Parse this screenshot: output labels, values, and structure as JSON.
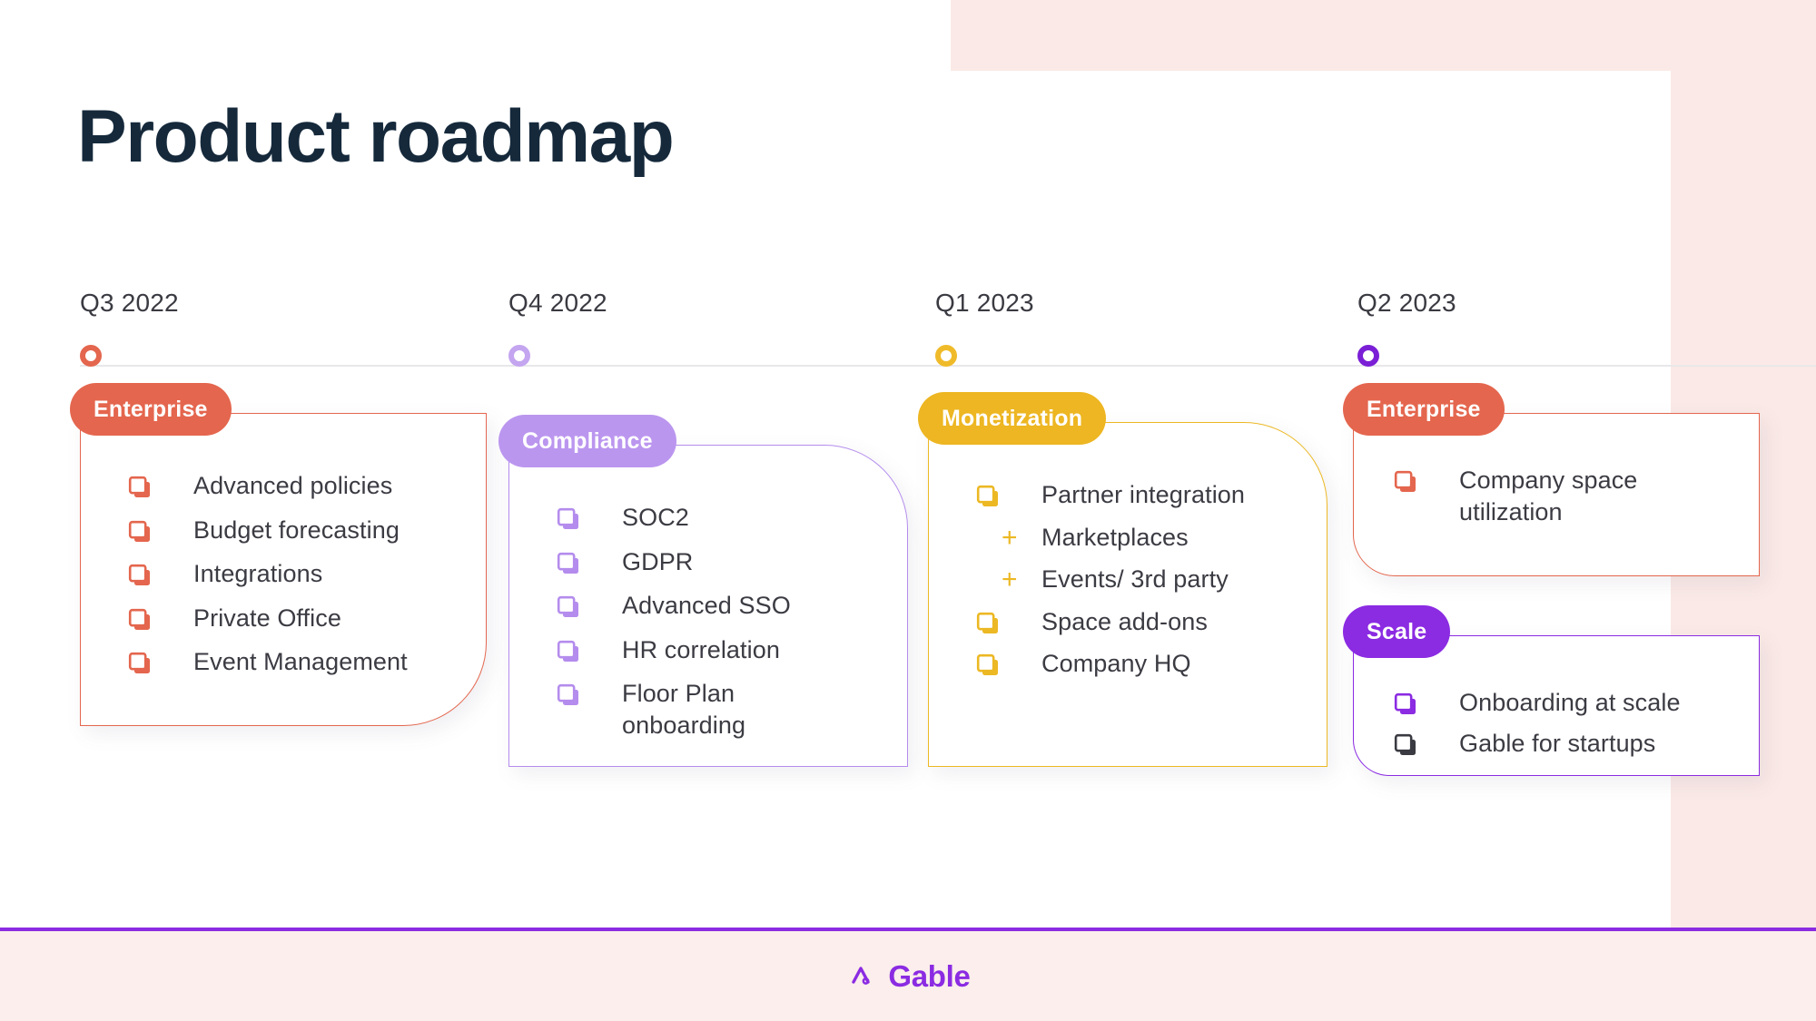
{
  "slide": {
    "title": "Product roadmap",
    "title_color": "#15293b",
    "background_color": "#ffffff",
    "accent_block_color": "#fae9e6"
  },
  "timeline": {
    "line_color": "#e8e8ea",
    "quarters": [
      {
        "label": "Q3 2022",
        "dot_color": "#e4664e"
      },
      {
        "label": "Q4 2022",
        "dot_color": "#c4a5f0"
      },
      {
        "label": "Q1 2023",
        "dot_color": "#f0bb2a"
      },
      {
        "label": "Q2 2023",
        "dot_color": "#7a1fd6"
      }
    ]
  },
  "columns": [
    {
      "quarter": "Q3 2022",
      "cards": [
        {
          "pill_label": "Enterprise",
          "color": "#e4664e",
          "pill_bg": "#e4664e",
          "items": [
            {
              "marker": "duplicate-icon",
              "text": "Advanced policies",
              "marker_color": "#e4664e"
            },
            {
              "marker": "duplicate-icon",
              "text": "Budget forecasting",
              "marker_color": "#e4664e"
            },
            {
              "marker": "duplicate-icon",
              "text": "Integrations",
              "marker_color": "#e4664e"
            },
            {
              "marker": "duplicate-icon",
              "text": "Private Office",
              "marker_color": "#e4664e"
            },
            {
              "marker": "duplicate-icon",
              "text": "Event Management",
              "marker_color": "#e4664e"
            }
          ]
        }
      ]
    },
    {
      "quarter": "Q4 2022",
      "cards": [
        {
          "pill_label": "Compliance",
          "color": "#b48ced",
          "pill_bg": "#bb96ef",
          "items": [
            {
              "marker": "duplicate-icon",
              "text": "SOC2",
              "marker_color": "#b48ced"
            },
            {
              "marker": "duplicate-icon",
              "text": "GDPR",
              "marker_color": "#b48ced"
            },
            {
              "marker": "duplicate-icon",
              "text": "Advanced SSO",
              "marker_color": "#b48ced"
            },
            {
              "marker": "duplicate-icon",
              "text": "HR correlation",
              "marker_color": "#b48ced"
            },
            {
              "marker": "duplicate-icon",
              "text": "Floor Plan onboarding",
              "marker_color": "#b48ced"
            }
          ]
        }
      ]
    },
    {
      "quarter": "Q1 2023",
      "cards": [
        {
          "pill_label": "Monetization",
          "color": "#ecb823",
          "pill_bg": "#edb622",
          "items": [
            {
              "marker": "duplicate-icon",
              "text": "Partner integration",
              "marker_color": "#ecb823"
            },
            {
              "marker": "plus-icon",
              "text": "Marketplaces",
              "marker_color": "#ecb823"
            },
            {
              "marker": "plus-icon",
              "text": "Events/ 3rd party",
              "marker_color": "#ecb823"
            },
            {
              "marker": "duplicate-icon",
              "text": "Space add-ons",
              "marker_color": "#ecb823"
            },
            {
              "marker": "duplicate-icon",
              "text": "Company HQ",
              "marker_color": "#ecb823"
            }
          ]
        }
      ]
    },
    {
      "quarter": "Q2 2023",
      "cards": [
        {
          "pill_label": "Enterprise",
          "color": "#e4664e",
          "pill_bg": "#e4664e",
          "items": [
            {
              "marker": "duplicate-icon",
              "text": "Company space utilization",
              "marker_color": "#e4664e"
            }
          ]
        },
        {
          "pill_label": "Scale",
          "color": "#8b2be2",
          "pill_bg": "#8b2be2",
          "items": [
            {
              "marker": "duplicate-icon",
              "text": "Onboarding at scale",
              "marker_color": "#8b2be2"
            },
            {
              "marker": "duplicate-icon",
              "text": "Gable for startups",
              "marker_color": "#3a3a42"
            }
          ]
        }
      ]
    }
  ],
  "footer": {
    "brand": "Gable",
    "brand_color": "#8b2be2",
    "background": "#fbeeec",
    "border_color": "#8b2be2",
    "logo_icon": "gable-chevron-icon"
  }
}
